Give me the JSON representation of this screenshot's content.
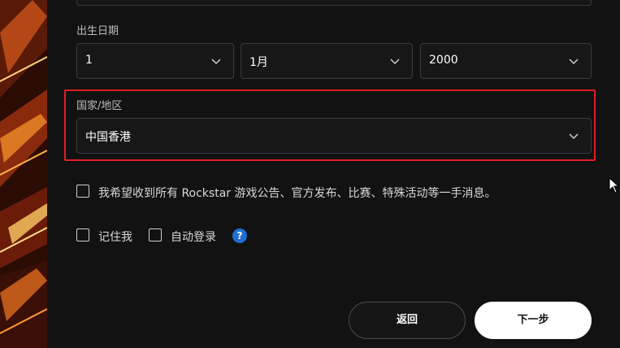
{
  "birthdate": {
    "label": "出生日期",
    "day": "1",
    "month": "1月",
    "year": "2000"
  },
  "region": {
    "label": "国家/地区",
    "value": "中国香港"
  },
  "options": {
    "newsletter": "我希望收到所有 Rockstar 游戏公告、官方发布、比赛、特殊活动等一手消息。",
    "remember_me": "记住我",
    "auto_login": "自动登录",
    "help_glyph": "?"
  },
  "buttons": {
    "back": "返回",
    "next": "下一步"
  },
  "colors": {
    "highlight": "#e01e25",
    "help_badge": "#1f6fd1",
    "panel": "#121212"
  }
}
